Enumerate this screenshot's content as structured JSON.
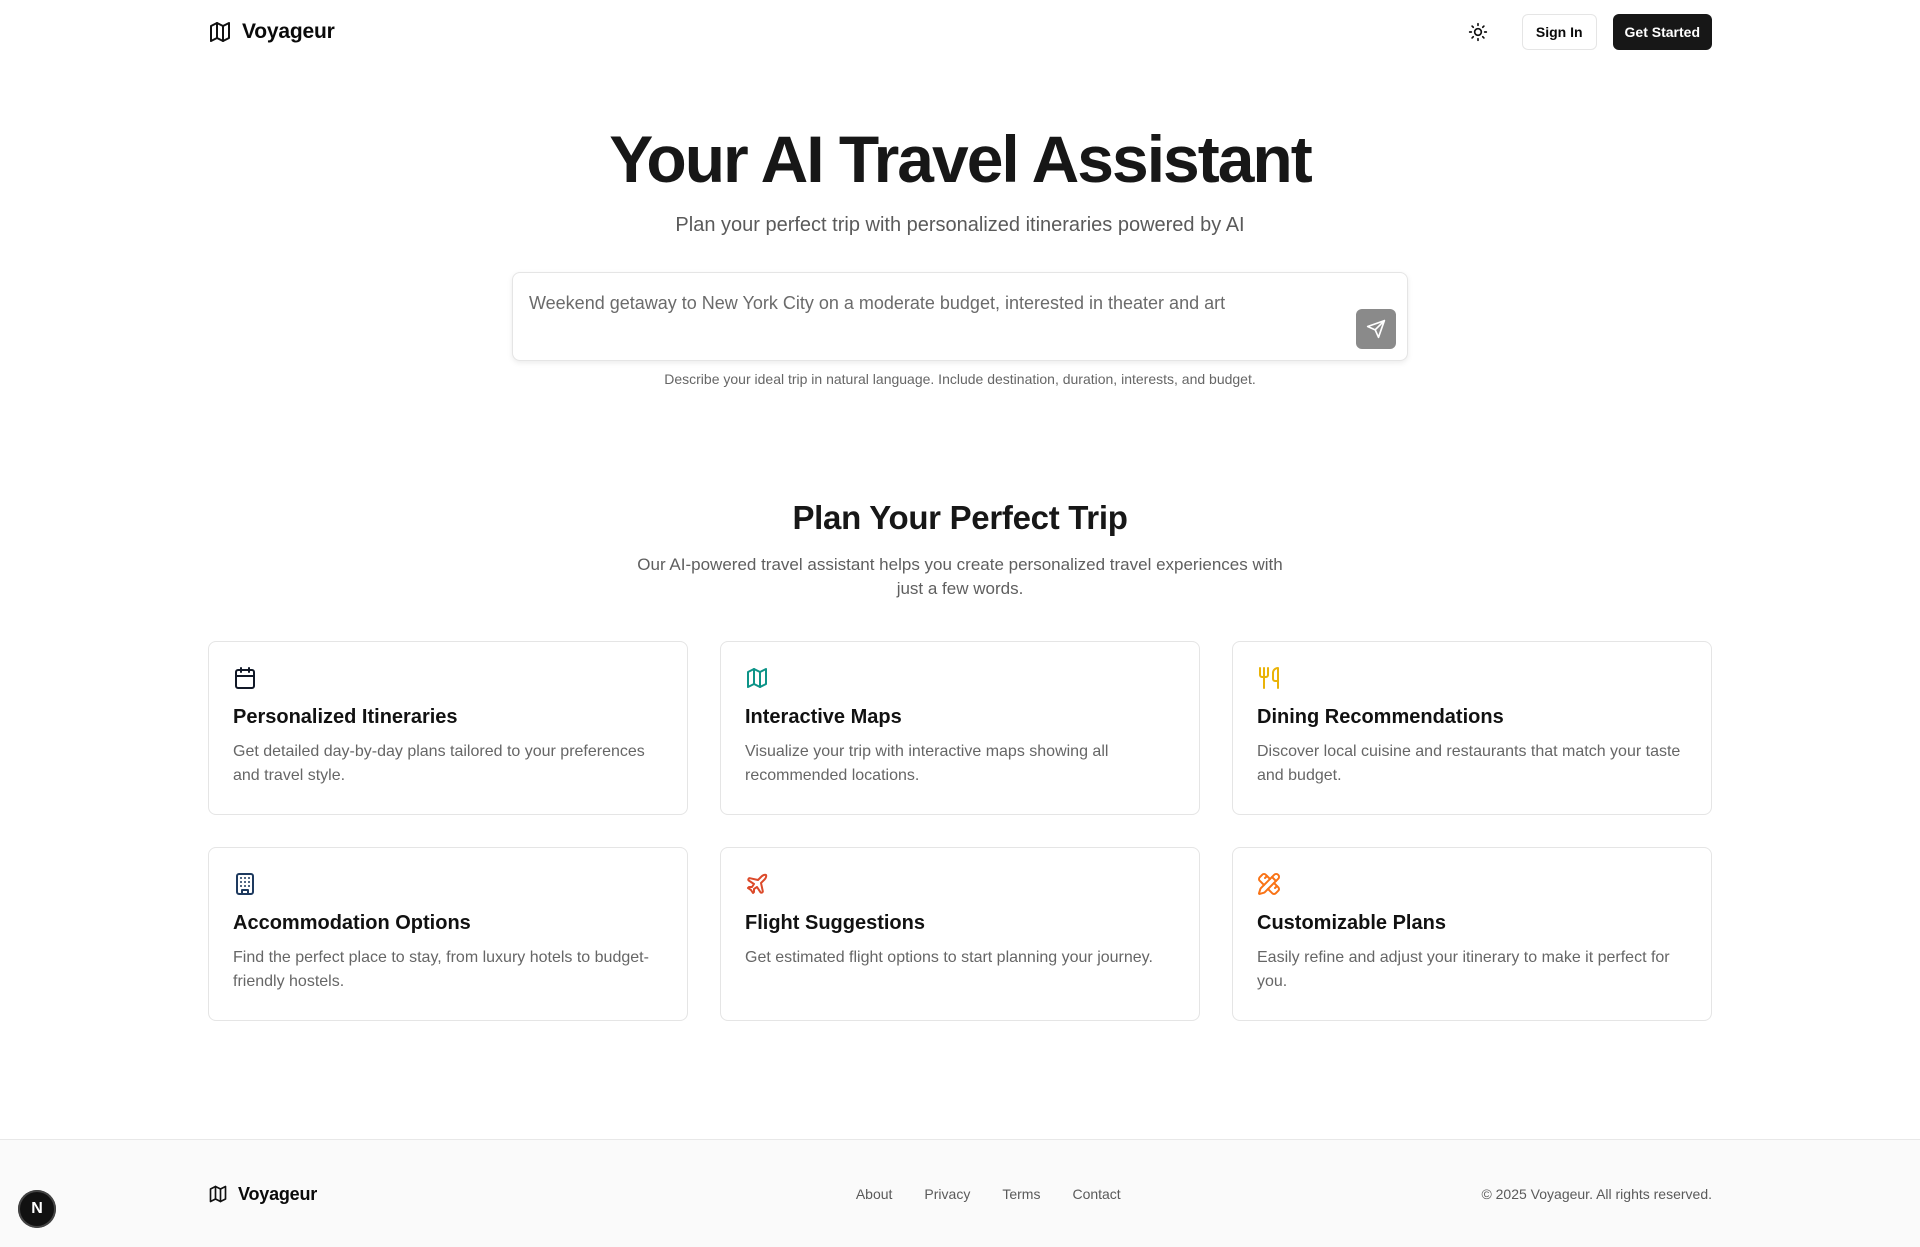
{
  "header": {
    "brand": "Voyageur",
    "sign_in": "Sign In",
    "get_started": "Get Started",
    "theme_icon": "sun-icon"
  },
  "hero": {
    "title": "Your AI Travel Assistant",
    "subtitle": "Plan your perfect trip with personalized itineraries powered by AI",
    "prompt_value": "Weekend getaway to New York City on a moderate budget, interested in theater and art",
    "hint": "Describe your ideal trip in natural language. Include destination, duration, interests, and budget."
  },
  "features": {
    "title": "Plan Your Perfect Trip",
    "subtitle": "Our AI-powered travel assistant helps you create personalized travel experiences with just a few words.",
    "cards": [
      {
        "title": "Personalized Itineraries",
        "desc": "Get detailed day-by-day plans tailored to your preferences and travel style.",
        "icon": "calendar-icon",
        "color": "#111827"
      },
      {
        "title": "Interactive Maps",
        "desc": "Visualize your trip with interactive maps showing all recommended locations.",
        "icon": "map-icon",
        "color": "#0d9488"
      },
      {
        "title": "Dining Recommendations",
        "desc": "Discover local cuisine and restaurants that match your taste and budget.",
        "icon": "utensils-icon",
        "color": "#eab308"
      },
      {
        "title": "Accommodation Options",
        "desc": "Find the perfect place to stay, from luxury hotels to budget-friendly hostels.",
        "icon": "building-icon",
        "color": "#1e3a5f"
      },
      {
        "title": "Flight Suggestions",
        "desc": "Get estimated flight options to start planning your journey.",
        "icon": "plane-icon",
        "color": "#dc4a2a"
      },
      {
        "title": "Customizable Plans",
        "desc": "Easily refine and adjust your itinerary to make it perfect for you.",
        "icon": "pencil-ruler-icon",
        "color": "#f97316"
      }
    ]
  },
  "footer": {
    "brand": "Voyageur",
    "links": [
      "About",
      "Privacy",
      "Terms",
      "Contact"
    ],
    "copyright": "© 2025 Voyageur. All rights reserved."
  },
  "dev_badge": "N"
}
